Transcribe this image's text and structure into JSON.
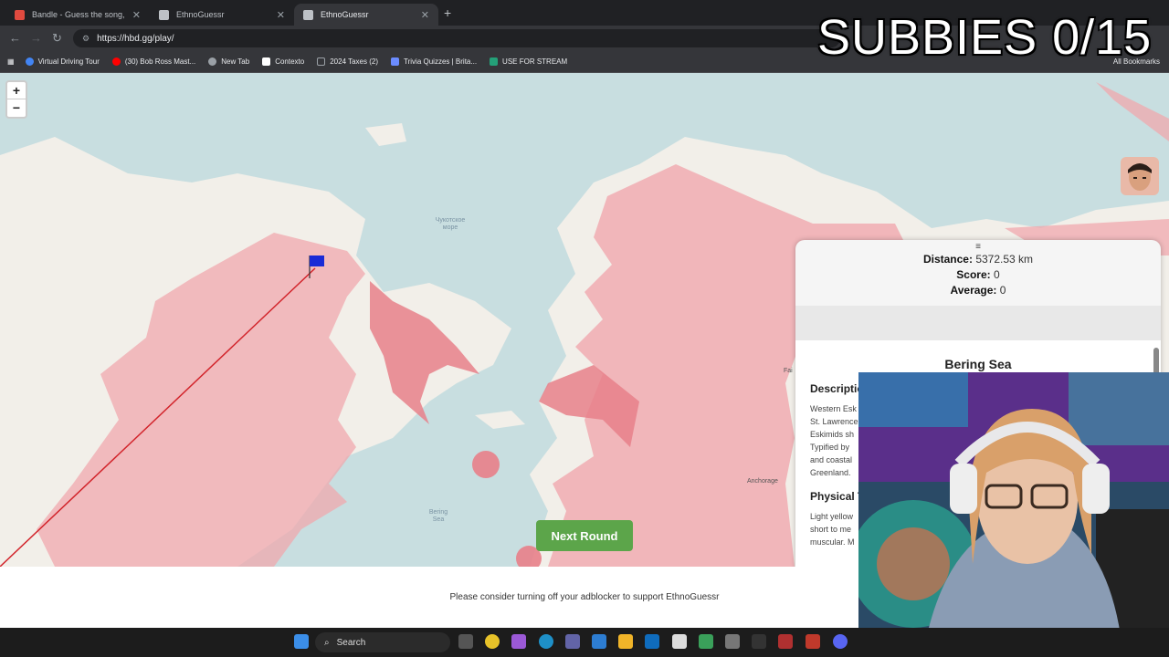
{
  "browser": {
    "tabs": [
      {
        "title": "Bandle - Guess the song, one in",
        "favicon_color": "#e04a3f",
        "active": false
      },
      {
        "title": "EthnoGuessr",
        "favicon_color": "#bdc1c6",
        "active": false
      },
      {
        "title": "EthnoGuessr",
        "favicon_color": "#bdc1c6",
        "active": true
      }
    ],
    "new_tab_glyph": "+",
    "url": "https://hbd.gg/play/",
    "bookmarks": [
      {
        "label": "Virtual Driving Tour",
        "icon_color": "#4285f4"
      },
      {
        "label": "(30) Bob Ross Mast...",
        "icon_color": "#ff0000"
      },
      {
        "label": "New Tab",
        "icon_color": "#9aa0a6"
      },
      {
        "label": "Contexto",
        "icon_color": "#ffffff"
      },
      {
        "label": "2024 Taxes (2)",
        "icon_color": "#9aa0a6"
      },
      {
        "label": "Trivia Quizzes | Brita...",
        "icon_color": "#6b8cff"
      },
      {
        "label": "USE FOR STREAM",
        "icon_color": "#24a078"
      }
    ],
    "all_bookmarks": "All Bookmarks"
  },
  "map": {
    "zoom_in": "+",
    "zoom_out": "−",
    "labels": {
      "chukchi_sea": "Чукотское\nморе",
      "bering_sea": "Bering\nSea",
      "anchorage": "Anchorage",
      "fairbanks": "Fai"
    },
    "next_round_label": "Next Round"
  },
  "result_panel": {
    "handle": "≡",
    "distance_label": "Distance:",
    "distance_value": "5372.53 km",
    "score_label": "Score:",
    "score_value": "0",
    "average_label": "Average:",
    "average_value": "0",
    "region_title": "Bering Sea",
    "description_heading": "Descriptio",
    "description_lines": [
      "Western Esk",
      "St. Lawrence",
      "Eskimids sh",
      "Typified by",
      "and coastal",
      "Greenland."
    ],
    "physical_heading": "Physical T",
    "physical_lines": [
      "Light yellow",
      "short to me",
      "muscular. M"
    ]
  },
  "footer": {
    "adblock_message": "Please consider turning off your adblocker to support EthnoGuessr"
  },
  "overlay": {
    "subbies_text": "SUBBIES 0/15"
  },
  "taskbar": {
    "search_label": "Search"
  },
  "colors": {
    "region_fill": "#e8808a",
    "region_fill_light": "#f0a8ae",
    "guess_line": "#d2232a",
    "flag": "#1a2bd6",
    "water": "#c8dee0",
    "land": "#f2efe9",
    "button": "#5ca54a"
  }
}
